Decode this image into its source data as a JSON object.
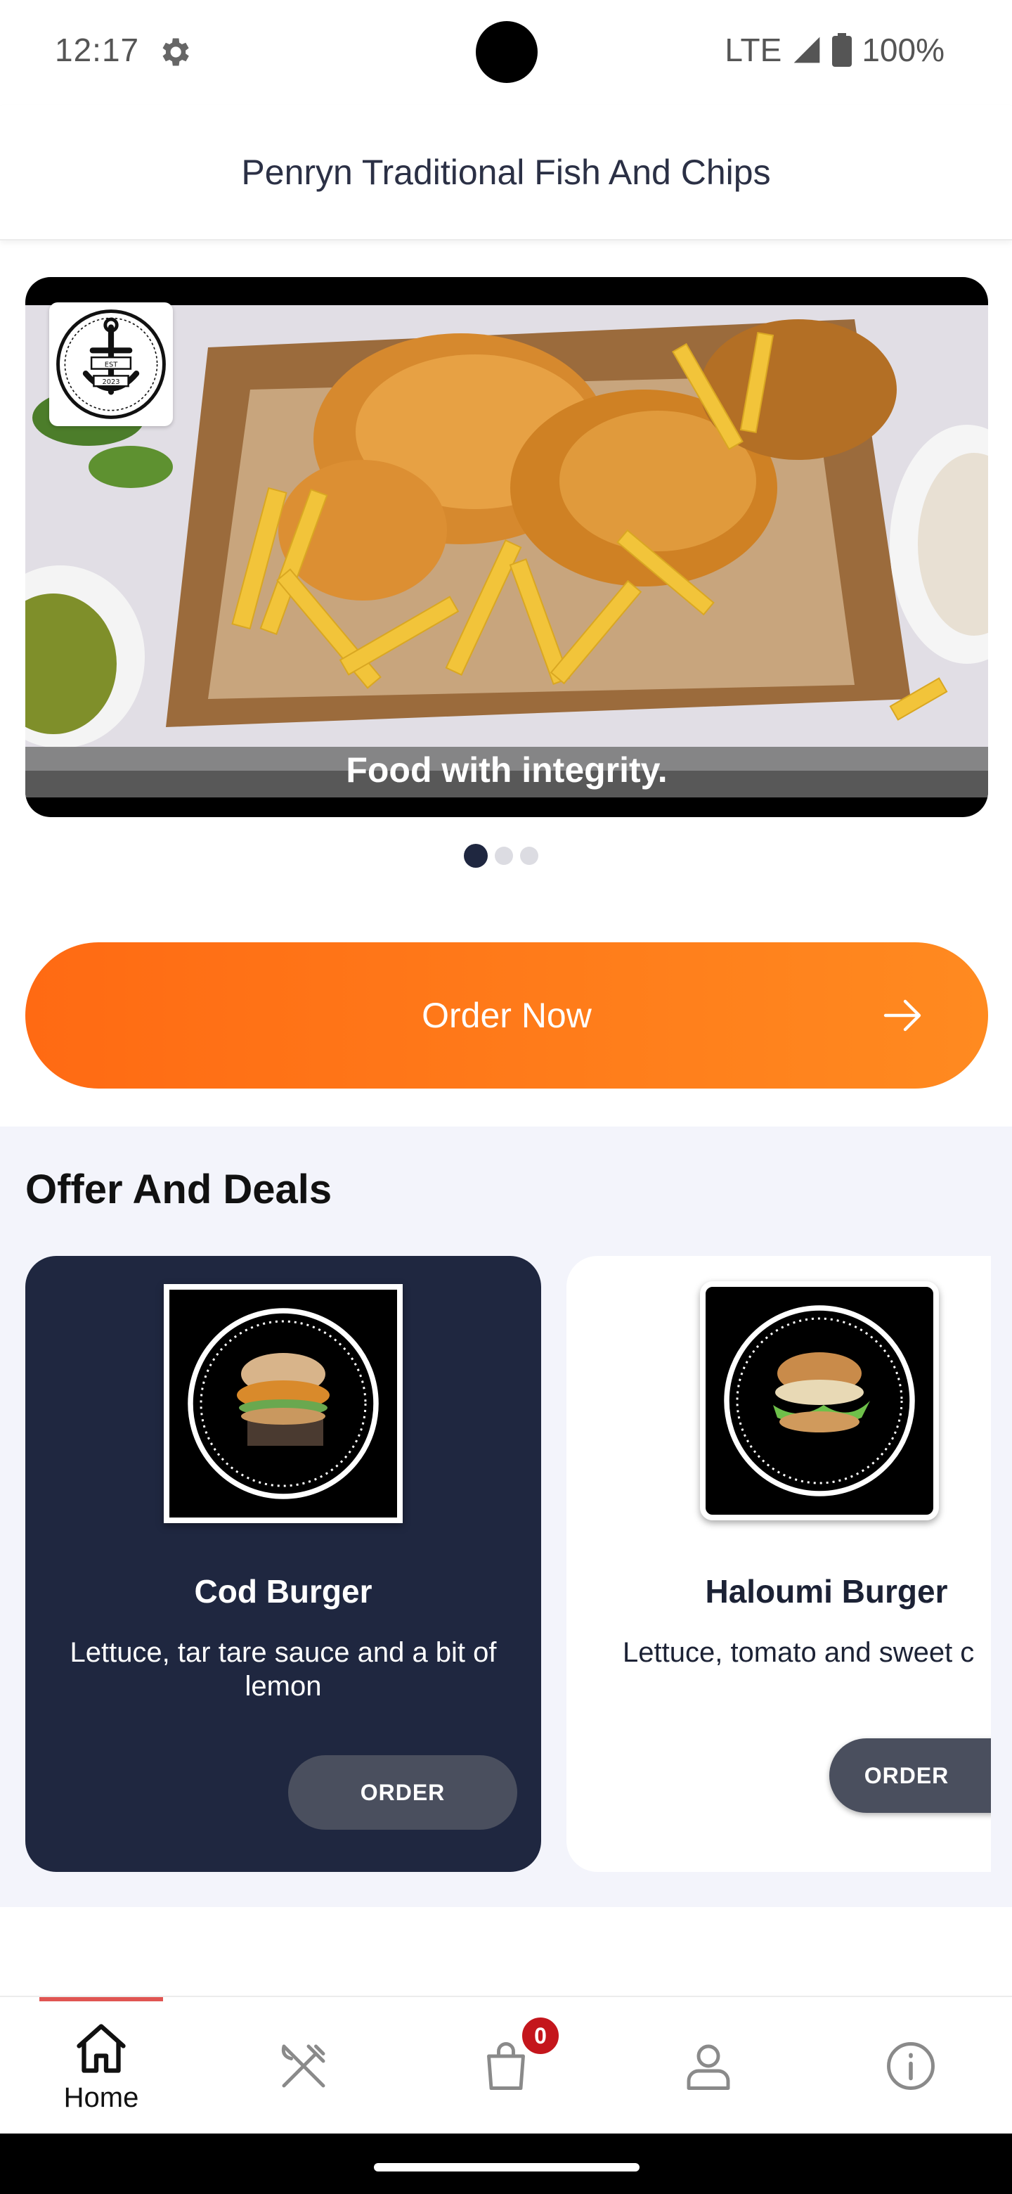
{
  "status_bar": {
    "time": "12:17",
    "network": "LTE",
    "battery": "100%",
    "icons": [
      "gear-icon",
      "signal-icon",
      "battery-icon"
    ]
  },
  "header": {
    "title": "Penryn Traditional Fish And Chips"
  },
  "banner": {
    "caption": "Food with integrity.",
    "logo_text_top": "EST",
    "logo_text_bottom": "2023",
    "slides_total": 3,
    "active_slide": 1
  },
  "order_now": {
    "label": "Order Now",
    "icon": "arrow-right-icon"
  },
  "offers": {
    "heading": "Offer And Deals",
    "items": [
      {
        "name": "Cod Burger",
        "description": "Lettuce, tar tare sauce and a bit of lemon",
        "button": "ORDER"
      },
      {
        "name": "Haloumi Burger",
        "description": "Lettuce, tomato and sweet c",
        "button": "ORDER"
      }
    ]
  },
  "bottom_nav": {
    "items": [
      {
        "label": "Home",
        "icon": "home-icon",
        "active": true
      },
      {
        "label": "",
        "icon": "fork-knife-icon"
      },
      {
        "label": "",
        "icon": "shopping-bag-icon"
      },
      {
        "label": "",
        "icon": "user-icon"
      },
      {
        "label": "",
        "icon": "info-icon"
      }
    ],
    "cart_count": "0"
  },
  "colors": {
    "accent_orange": "#ff6a13",
    "navy": "#1f2740",
    "badge_red": "#c4161c",
    "active_line": "#e05552"
  }
}
